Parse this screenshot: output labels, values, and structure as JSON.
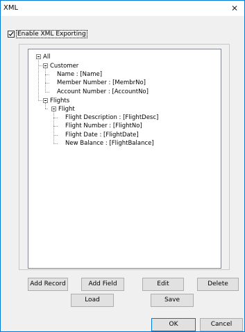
{
  "window": {
    "title": "XML",
    "close_glyph": "✕"
  },
  "export": {
    "enable_label": "Enable XML Exporting",
    "checked": true
  },
  "tree": {
    "root": "All",
    "customer": "Customer",
    "name": "Name : [Name]",
    "member_number": "Member Number : [MembrNo]",
    "account_number": "Account Number : [AccountNo]",
    "flights": "Flights",
    "flight": "Flight",
    "flight_description": "Flight Description : [FlightDesc]",
    "flight_number": "Flight Number : [FlightNo]",
    "flight_date": "Flight Date : [FlightDate]",
    "new_balance": "New Balance : [FlightBalance]"
  },
  "buttons": {
    "add_record": "Add Record",
    "add_field": "Add Field",
    "edit": "Edit",
    "delete": "Delete",
    "load": "Load",
    "save": "Save",
    "ok": "OK",
    "cancel": "Cancel"
  },
  "colors": {
    "accent": "#0078d7",
    "dialog_bg": "#f0f0f0"
  }
}
